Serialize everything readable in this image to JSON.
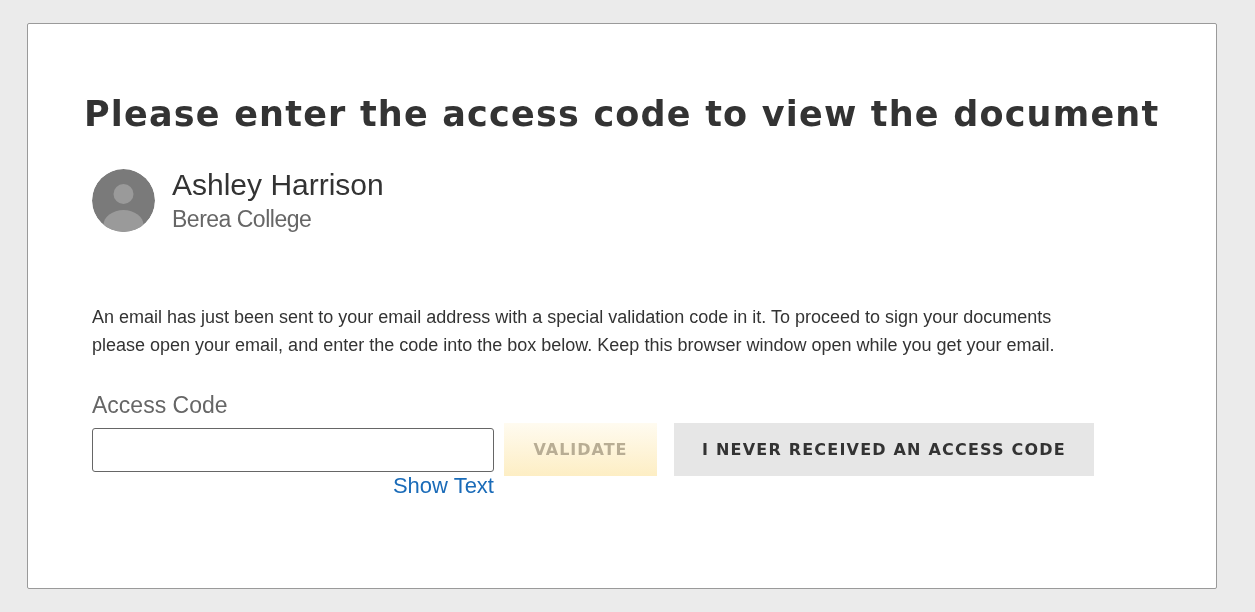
{
  "title": "Please enter the access code to view the document",
  "sender": {
    "name": "Ashley Harrison",
    "organization": "Berea College"
  },
  "message": "An email has just been sent to your email address with a special validation code in it. To proceed to sign your documents please open your email, and enter the code into the box below. Keep this browser window open while you get your email.",
  "access_code": {
    "label": "Access Code",
    "show_text_link": "Show Text"
  },
  "validate_button": {
    "label": "VALIDATE",
    "disabled": true
  },
  "no_code_button": {
    "label": "I NEVER RECEIVED AN ACCESS CODE"
  }
}
